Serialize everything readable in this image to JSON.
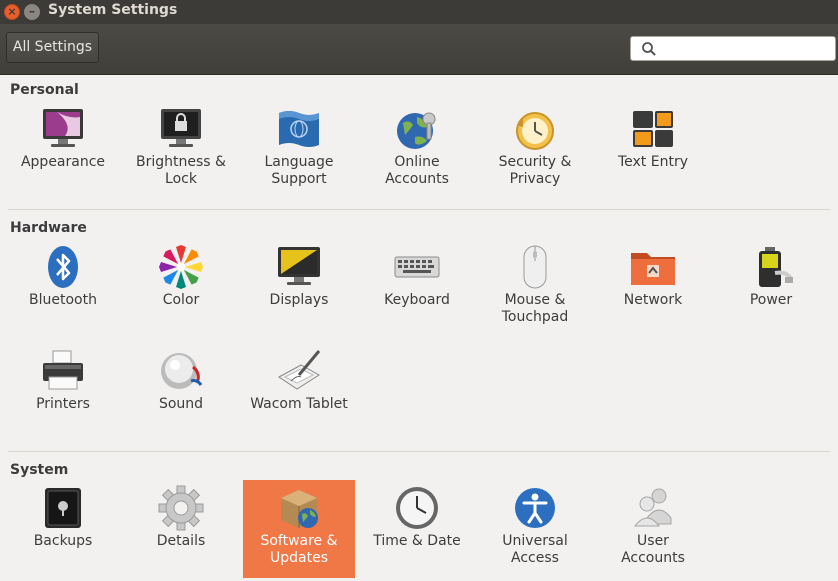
{
  "window": {
    "title": "System Settings"
  },
  "toolbar": {
    "all_settings_label": "All Settings",
    "search_placeholder": ""
  },
  "sections": {
    "personal": {
      "title": "Personal",
      "items": [
        {
          "label": "Appearance"
        },
        {
          "label": "Brightness &\nLock"
        },
        {
          "label": "Language\nSupport"
        },
        {
          "label": "Online\nAccounts"
        },
        {
          "label": "Security &\nPrivacy"
        },
        {
          "label": "Text Entry"
        }
      ]
    },
    "hardware": {
      "title": "Hardware",
      "items": [
        {
          "label": "Bluetooth"
        },
        {
          "label": "Color"
        },
        {
          "label": "Displays"
        },
        {
          "label": "Keyboard"
        },
        {
          "label": "Mouse &\nTouchpad"
        },
        {
          "label": "Network"
        },
        {
          "label": "Power"
        },
        {
          "label": "Printers"
        },
        {
          "label": "Sound"
        },
        {
          "label": "Wacom Tablet"
        }
      ]
    },
    "system": {
      "title": "System",
      "items": [
        {
          "label": "Backups"
        },
        {
          "label": "Details"
        },
        {
          "label": "Software &\nUpdates",
          "selected": true
        },
        {
          "label": "Time & Date"
        },
        {
          "label": "Universal\nAccess"
        },
        {
          "label": "User\nAccounts"
        }
      ]
    }
  },
  "colors": {
    "titlebar": "#3c3b37",
    "selection": "#f07746",
    "background": "#f2f1f0"
  }
}
